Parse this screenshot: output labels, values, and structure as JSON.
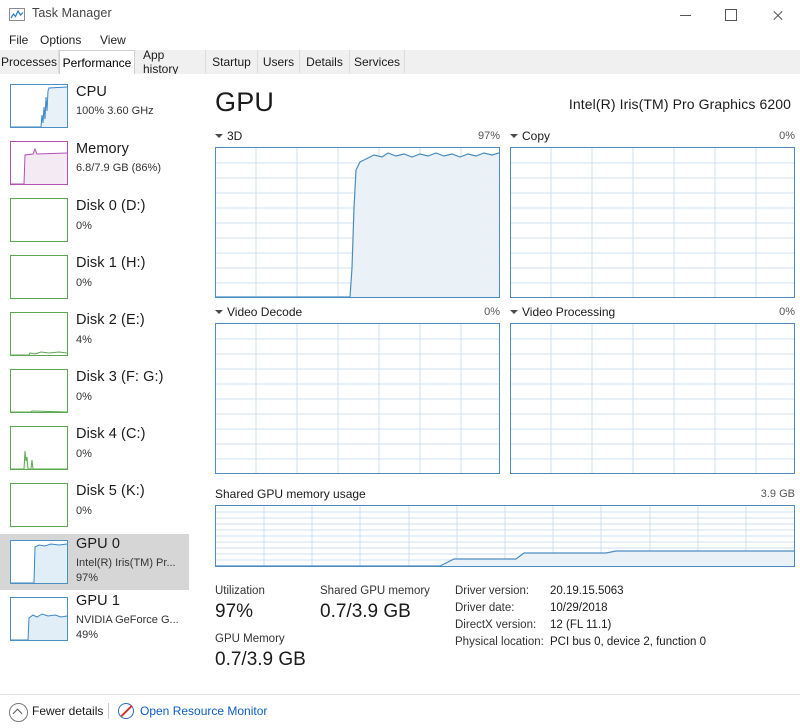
{
  "window": {
    "title": "Task Manager",
    "icon": "task-manager-icon",
    "controls": {
      "minimize": "–",
      "maximize": "□",
      "close": "✕"
    }
  },
  "menu": {
    "items": [
      "File",
      "Options",
      "View"
    ]
  },
  "tabs": {
    "items": [
      "Processes",
      "Performance",
      "App history",
      "Startup",
      "Users",
      "Details",
      "Services"
    ],
    "active": "Performance"
  },
  "sidebar": {
    "items": [
      {
        "title": "CPU",
        "sub": "100% 3.60 GHz",
        "sub2": "",
        "color": "#4a90c4",
        "selected": false
      },
      {
        "title": "Memory",
        "sub": "6.8/7.9 GB (86%)",
        "sub2": "",
        "color": "#b451b4",
        "selected": false
      },
      {
        "title": "Disk 0 (D:)",
        "sub": "0%",
        "sub2": "",
        "color": "#5aa84f",
        "selected": false
      },
      {
        "title": "Disk 1 (H:)",
        "sub": "0%",
        "sub2": "",
        "color": "#5aa84f",
        "selected": false
      },
      {
        "title": "Disk 2 (E:)",
        "sub": "4%",
        "sub2": "",
        "color": "#5aa84f",
        "selected": false
      },
      {
        "title": "Disk 3 (F: G:)",
        "sub": "0%",
        "sub2": "",
        "color": "#5aa84f",
        "selected": false
      },
      {
        "title": "Disk 4 (C:)",
        "sub": "0%",
        "sub2": "",
        "color": "#5aa84f",
        "selected": false
      },
      {
        "title": "Disk 5 (K:)",
        "sub": "0%",
        "sub2": "",
        "color": "#5aa84f",
        "selected": false
      },
      {
        "title": "GPU 0",
        "sub": "Intel(R) Iris(TM) Pr...",
        "sub2": "97%",
        "color": "#4a90c4",
        "selected": true
      },
      {
        "title": "GPU 1",
        "sub": "NVIDIA GeForce G...",
        "sub2": "49%",
        "color": "#4a90c4",
        "selected": false
      }
    ]
  },
  "main": {
    "title": "GPU",
    "device": "Intel(R) Iris(TM) Pro Graphics 6200",
    "charts": [
      {
        "label": "3D",
        "value": "97%"
      },
      {
        "label": "Copy",
        "value": "0%"
      },
      {
        "label": "Video Decode",
        "value": "0%"
      },
      {
        "label": "Video Processing",
        "value": "0%"
      }
    ],
    "memory_chart": {
      "label": "Shared GPU memory usage",
      "value": "3.9 GB"
    },
    "stats": [
      {
        "label": "Utilization",
        "value": "97%"
      },
      {
        "label": "Shared GPU memory",
        "value": "0.7/3.9 GB"
      },
      {
        "label": "GPU Memory",
        "value": "0.7/3.9 GB"
      }
    ],
    "info": [
      {
        "key": "Driver version:",
        "value": "20.19.15.5063"
      },
      {
        "key": "Driver date:",
        "value": "10/29/2018"
      },
      {
        "key": "DirectX version:",
        "value": "12 (FL 11.1)"
      },
      {
        "key": "Physical location:",
        "value": "PCI bus 0, device 2, function 0"
      }
    ]
  },
  "footer": {
    "fewer_details": "Fewer details",
    "resource_monitor": "Open Resource Monitor"
  },
  "colors": {
    "accent_blue": "#4b8cc0",
    "fill_blue": "#eaf2f8",
    "grid": "#cfe0ef",
    "link": "#0b5ec1",
    "selected_row": "#d6d6d6"
  },
  "chart_data": {
    "type": "line",
    "title": "GPU engine utilization over time",
    "ylim": [
      0,
      100
    ],
    "grid": true,
    "series": [
      {
        "name": "3D",
        "ylabel": "%",
        "peak": 97,
        "values": [
          0,
          0,
          0,
          0,
          0,
          0,
          0,
          0,
          0,
          0,
          0,
          0,
          0,
          0,
          0,
          0,
          0,
          0,
          0,
          0,
          0,
          0,
          0,
          0,
          0,
          0,
          0,
          0,
          0,
          0,
          0,
          0,
          0,
          0,
          0,
          0,
          0,
          0,
          0,
          0,
          0,
          0,
          0,
          0,
          0,
          0,
          4,
          62,
          86,
          91,
          93,
          92,
          95,
          97,
          94,
          96,
          93,
          95,
          94,
          93,
          95,
          94,
          96,
          95,
          97,
          95,
          93,
          92,
          94,
          96,
          97,
          95,
          94,
          93,
          92,
          94,
          96,
          95,
          93,
          92,
          94,
          96,
          95,
          94,
          93,
          95,
          96,
          94,
          93,
          95,
          96,
          97,
          95,
          94,
          96,
          95,
          94,
          96,
          95,
          97
        ]
      },
      {
        "name": "Copy",
        "ylabel": "%",
        "peak": 0,
        "values": []
      },
      {
        "name": "Video Decode",
        "ylabel": "%",
        "peak": 0,
        "values": []
      },
      {
        "name": "Video Processing",
        "ylabel": "%",
        "peak": 0,
        "values": []
      },
      {
        "name": "Shared GPU memory usage",
        "ylabel": "GB",
        "ylim": [
          0,
          3.9
        ],
        "values": [
          0,
          0,
          0,
          0,
          0,
          0,
          0,
          0,
          0,
          0,
          0,
          0,
          0,
          0,
          0,
          0,
          0,
          0,
          0,
          0,
          0,
          0,
          0,
          0,
          0,
          0,
          0,
          0,
          0,
          0,
          0,
          0,
          0,
          0,
          0,
          0,
          0,
          0,
          0,
          0,
          0,
          0,
          0.1,
          0.2,
          0.3,
          0.35,
          0.38,
          0.4,
          0.4,
          0.4,
          0.4,
          0.4,
          0.4,
          0.4,
          0.4,
          0.4,
          0.42,
          0.55,
          0.62,
          0.63,
          0.63,
          0.63,
          0.63,
          0.63,
          0.63,
          0.63,
          0.63,
          0.65,
          0.68,
          0.7,
          0.7,
          0.7,
          0.7,
          0.7,
          0.7,
          0.7,
          0.7,
          0.7,
          0.7,
          0.7,
          0.7,
          0.7,
          0.7,
          0.7,
          0.7,
          0.7,
          0.7,
          0.7,
          0.7,
          0.7,
          0.7,
          0.7,
          0.7,
          0.7,
          0.7,
          0.7,
          0.7,
          0.7,
          0.7,
          0.7
        ]
      }
    ]
  }
}
